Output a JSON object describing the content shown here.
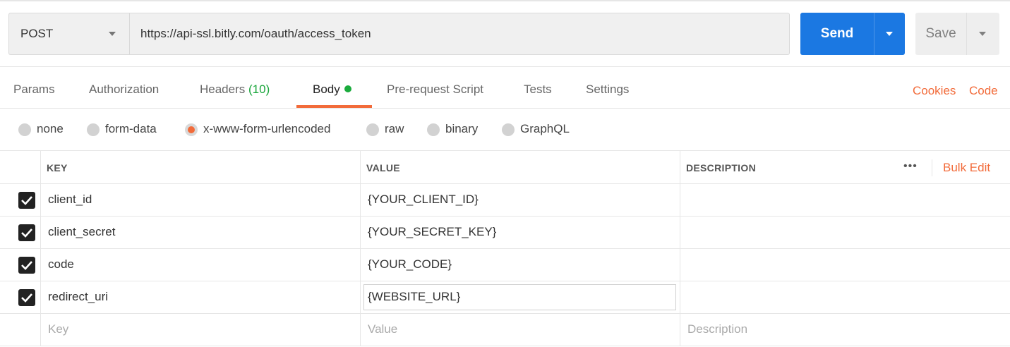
{
  "request": {
    "method": "POST",
    "url": "https://api-ssl.bitly.com/oauth/access_token",
    "send_label": "Send",
    "save_label": "Save"
  },
  "tabs": [
    {
      "label": "Params"
    },
    {
      "label": "Authorization"
    },
    {
      "label": "Headers",
      "count": "(10)"
    },
    {
      "label": "Body",
      "active": true
    },
    {
      "label": "Pre-request Script"
    },
    {
      "label": "Tests"
    },
    {
      "label": "Settings"
    }
  ],
  "links": {
    "cookies": "Cookies",
    "code": "Code"
  },
  "body_types": [
    {
      "label": "none",
      "selected": false
    },
    {
      "label": "form-data",
      "selected": false
    },
    {
      "label": "x-www-form-urlencoded",
      "selected": true
    },
    {
      "label": "raw",
      "selected": false
    },
    {
      "label": "binary",
      "selected": false
    },
    {
      "label": "GraphQL",
      "selected": false
    }
  ],
  "table": {
    "headers": {
      "key": "KEY",
      "value": "VALUE",
      "description": "DESCRIPTION"
    },
    "bulk_edit": "Bulk Edit",
    "rows": [
      {
        "key": "client_id",
        "value": "{YOUR_CLIENT_ID}",
        "checked": true
      },
      {
        "key": "client_secret",
        "value": "{YOUR_SECRET_KEY}",
        "checked": true
      },
      {
        "key": "code",
        "value": "{YOUR_CODE}",
        "checked": true
      },
      {
        "key": "redirect_uri",
        "value": "{WEBSITE_URL}",
        "checked": true
      }
    ],
    "placeholder": {
      "key": "Key",
      "value": "Value",
      "description": "Description"
    }
  },
  "colors": {
    "accent": "#f26b3a",
    "primary": "#1b78e2",
    "success": "#1aab3c"
  }
}
